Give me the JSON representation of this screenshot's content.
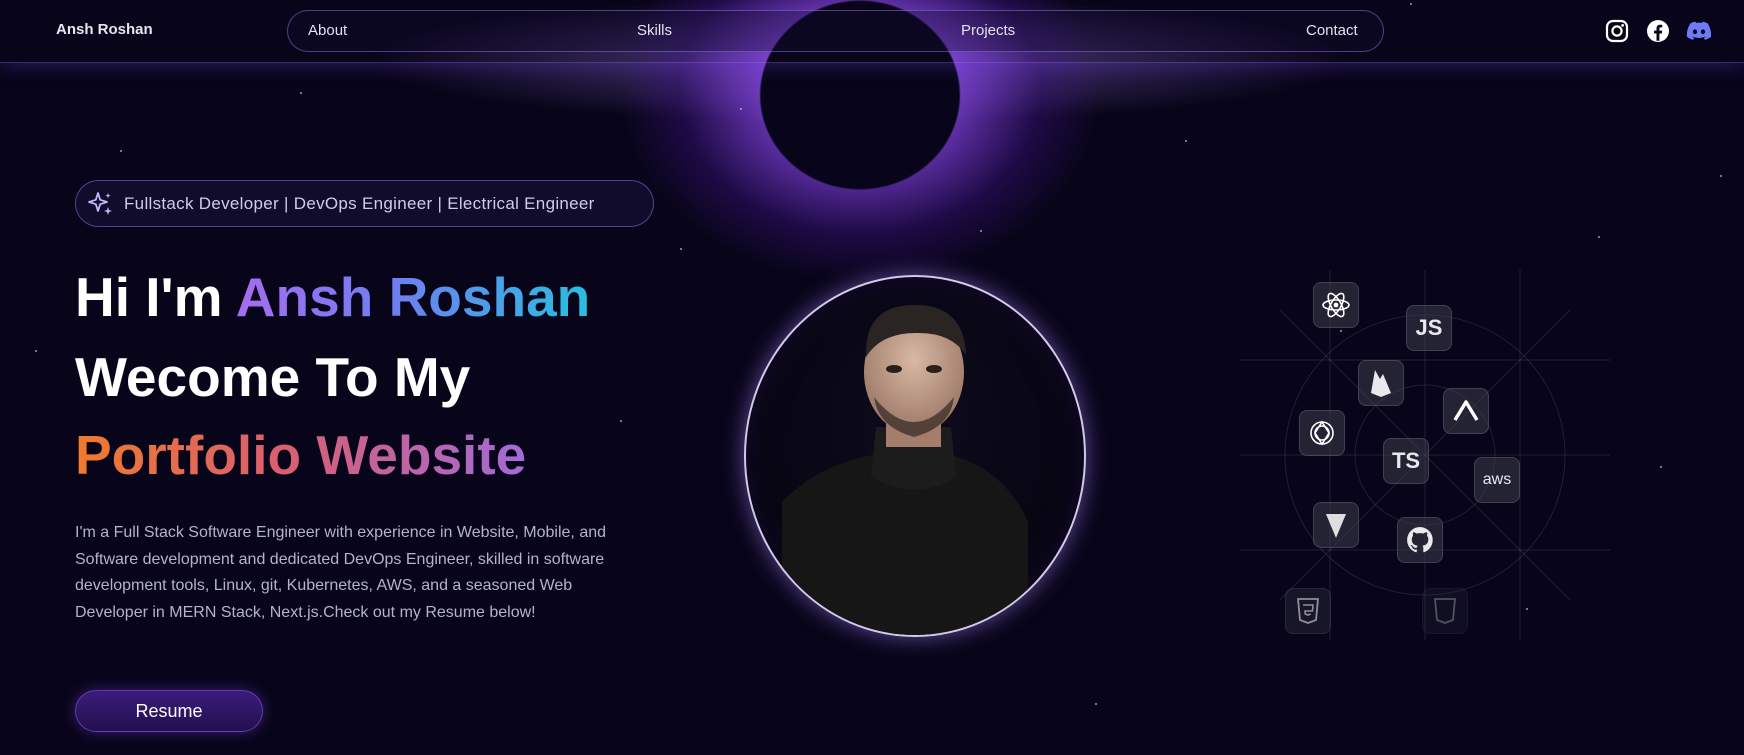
{
  "header": {
    "brand": "Ansh Roshan",
    "nav": [
      "About",
      "Skills",
      "Projects",
      "Contact"
    ],
    "socials": [
      "instagram-icon",
      "facebook-icon",
      "discord-icon"
    ]
  },
  "hero": {
    "roles": "Fullstack Developer | DevOps Engineer | Electrical Engineer",
    "line1_prefix": "Hi I'm ",
    "line1_name": "Ansh Roshan",
    "line2": "Wecome To My",
    "line3": "Portfolio Website",
    "description": "I'm a Full Stack Software Engineer with experience in Website, Mobile, and Software development and dedicated DevOps Engineer, skilled in software development tools, Linux, git, Kubernetes, AWS, and a seasoned Web Developer in MERN Stack, Next.js.Check out my Resume below!",
    "resume_label": "Resume"
  },
  "tech": {
    "js_label": "JS",
    "ts_label": "TS",
    "aws_label": "aws",
    "icons": [
      "react-icon",
      "javascript-icon",
      "firebase-icon",
      "nextjs-icon",
      "openai-icon",
      "typescript-icon",
      "aws-icon",
      "vite-icon",
      "github-icon",
      "html5-icon",
      "css3-icon"
    ]
  },
  "colors": {
    "background": "#08051a",
    "name_gradient": [
      "#a76cf0",
      "#26c0e0"
    ],
    "portfolio_gradient": [
      "#f07a2c",
      "#a36ad8"
    ],
    "accent": "#7c4dff"
  }
}
